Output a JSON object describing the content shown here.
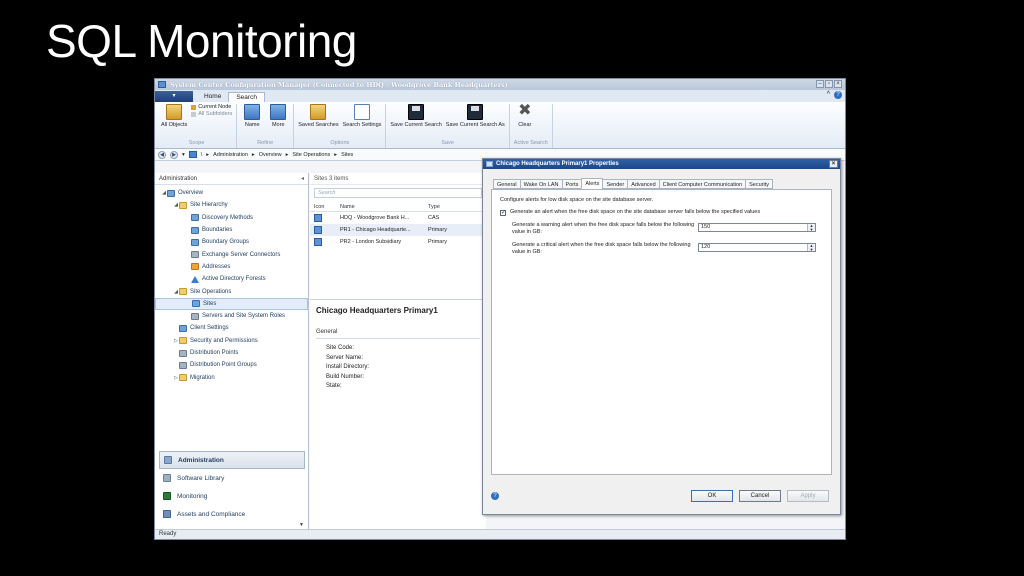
{
  "slide_title": "SQL Monitoring",
  "window": {
    "title": "System Center Configuration Manager (Connected to HDQ - Woodgrove Bank Headquarters)",
    "controls": [
      "–",
      "▫",
      "×"
    ]
  },
  "ribbon": {
    "tabs": [
      "Home",
      "Search"
    ],
    "active_tab": "Search",
    "groups": [
      {
        "label": "Scope",
        "buttons": [
          "All Objects"
        ],
        "options": [
          "Current Node",
          "All Subfolders"
        ]
      },
      {
        "label": "Refine",
        "buttons": [
          "Name",
          "More"
        ]
      },
      {
        "label": "Options",
        "buttons": [
          "Saved Searches",
          "Search Settings"
        ]
      },
      {
        "label": "Save",
        "buttons": [
          "Save Current Search",
          "Save Current Search As"
        ]
      },
      {
        "label": "Active Search",
        "buttons": [
          "Clear"
        ]
      }
    ]
  },
  "breadcrumb": [
    "\\",
    "Administration",
    "Overview",
    "Site Operations",
    "Sites"
  ],
  "nav": {
    "header": "Administration",
    "tree": [
      {
        "label": "Overview",
        "level": 0,
        "icon": "overview",
        "exp": "◢"
      },
      {
        "label": "Site Hierarchy",
        "level": 1,
        "icon": "folder",
        "exp": "◢"
      },
      {
        "label": "Discovery Methods",
        "level": 2,
        "icon": "blue"
      },
      {
        "label": "Boundaries",
        "level": 2,
        "icon": "blue"
      },
      {
        "label": "Boundary Groups",
        "level": 2,
        "icon": "blue"
      },
      {
        "label": "Exchange Server Connectors",
        "level": 2,
        "icon": "gray"
      },
      {
        "label": "Addresses",
        "level": 2,
        "icon": "orange"
      },
      {
        "label": "Active Directory Forests",
        "level": 2,
        "icon": "tri"
      },
      {
        "label": "Site Operations",
        "level": 1,
        "icon": "folder",
        "exp": "◢"
      },
      {
        "label": "Sites",
        "level": 2,
        "icon": "blue",
        "selected": true
      },
      {
        "label": "Servers and Site System Roles",
        "level": 2,
        "icon": "gray"
      },
      {
        "label": "Client Settings",
        "level": 1,
        "icon": "blue"
      },
      {
        "label": "Security and Permissions",
        "level": 1,
        "icon": "folder",
        "exp": "▷"
      },
      {
        "label": "Distribution Points",
        "level": 1,
        "icon": "gray"
      },
      {
        "label": "Distribution Point Groups",
        "level": 1,
        "icon": "gray"
      },
      {
        "label": "Migration",
        "level": 1,
        "icon": "folder",
        "exp": "▷"
      }
    ],
    "workspaces": [
      {
        "label": "Administration",
        "active": true
      },
      {
        "label": "Software Library",
        "active": false
      },
      {
        "label": "Monitoring",
        "active": false
      },
      {
        "label": "Assets and Compliance",
        "active": false
      }
    ]
  },
  "list": {
    "header": "Sites 3 items",
    "search_placeholder": "Search",
    "columns": [
      "Icon",
      "Name",
      "Type"
    ],
    "rows": [
      {
        "name": "HDQ - Woodgrove Bank H...",
        "type": "CAS"
      },
      {
        "name": "PR1 - Chicago Headquarte...",
        "type": "Primary"
      },
      {
        "name": "PR2 - London Subsidiary",
        "type": "Primary"
      }
    ]
  },
  "details": {
    "title": "Chicago Headquarters Primary1",
    "section": "General",
    "fields": [
      "Site Code:",
      "Server Name:",
      "Install Directory:",
      "Build Number:",
      "State:"
    ]
  },
  "dialog": {
    "title": "Chicago Headquarters Primary1 Properties",
    "tabs": [
      "General",
      "Wake On LAN",
      "Ports",
      "Alerts",
      "Sender",
      "Advanced",
      "Client Computer Communication",
      "Security"
    ],
    "active_tab": "Alerts",
    "intro": "Configure alerts for low disk space on the site database server.",
    "check_label": "Generate an alert when the free disk space on the site database server falls below the specified values",
    "checked": true,
    "warning_label": "Generate a warning alert when the free disk space falls below the following value in GB:",
    "warning_value": "150",
    "critical_label": "Generate a critical alert when the free disk space falls below the following value in GB:",
    "critical_value": "120",
    "buttons": {
      "ok": "OK",
      "cancel": "Cancel",
      "apply": "Apply"
    }
  },
  "status": "Ready"
}
